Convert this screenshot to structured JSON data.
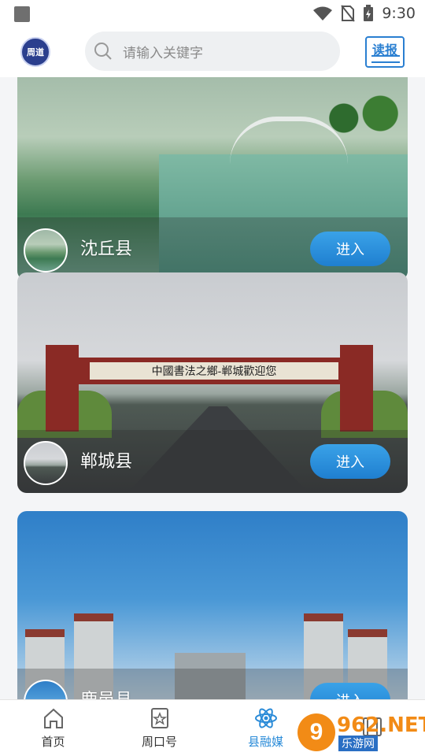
{
  "status_bar": {
    "time": "9:30"
  },
  "header": {
    "logo_text": "周道",
    "search_placeholder": "请输入关键字",
    "read_button": "读报"
  },
  "cards": [
    {
      "name": "沈丘县",
      "enter_label": "进入"
    },
    {
      "name": "郸城县",
      "enter_label": "进入",
      "sign_text": "中國書法之鄉-郸城歡迎您"
    },
    {
      "name": "鹿邑县",
      "enter_label": "进入"
    }
  ],
  "tabs": [
    {
      "label": "首页",
      "icon": "home-icon",
      "active": false
    },
    {
      "label": "周口号",
      "icon": "star-card-icon",
      "active": false
    },
    {
      "label": "县融媒",
      "icon": "atom-icon",
      "active": true
    },
    {
      "label": "",
      "icon": "film-icon",
      "active": false
    }
  ],
  "watermark": {
    "num": "962.NET",
    "sub": "乐游网",
    "badge": "9"
  },
  "colors": {
    "accent": "#2a8bd8",
    "button": "#1f7fd0"
  }
}
